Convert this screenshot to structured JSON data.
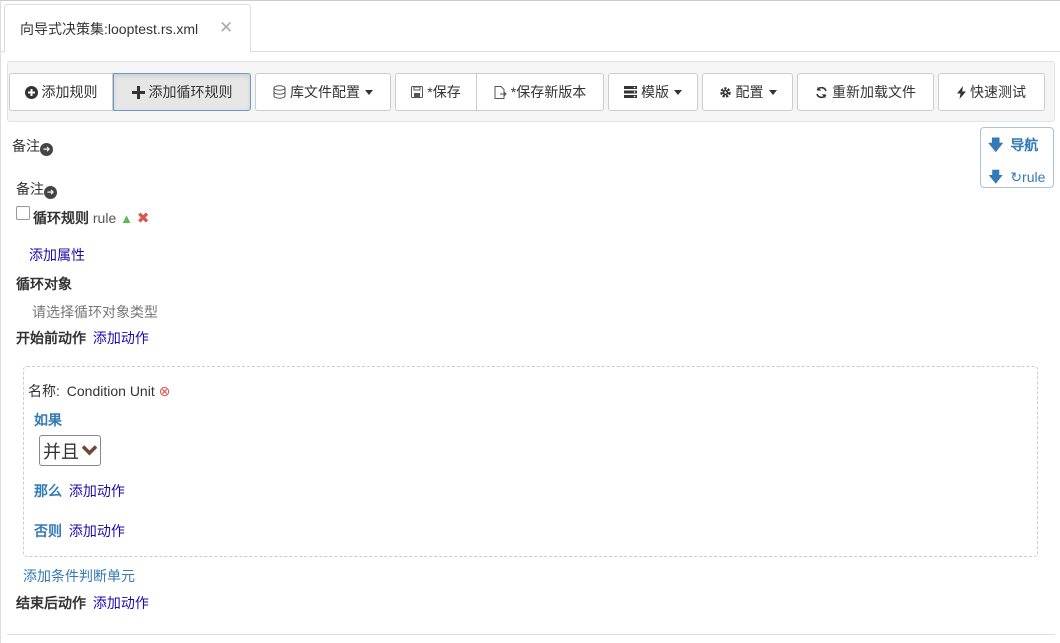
{
  "tab": {
    "title": "向导式决策集:looptest.rs.xml",
    "close": "✕"
  },
  "toolbar": {
    "add_rule": "添加规则",
    "add_loop_rule": "添加循环规则",
    "lib_config": "库文件配置",
    "save": "*保存",
    "save_new_version": "*保存新版本",
    "template": "模版",
    "config": "配置",
    "reload": "重新加载文件",
    "quick_test": "快速测试"
  },
  "nav": {
    "nav_label": "导航",
    "rule_label": "rule"
  },
  "remark_top": "备注",
  "rule": {
    "remark": "备注",
    "type_label": "循环规则",
    "name": "rule",
    "add_attribute": "添加属性",
    "loop_object_label": "循环对象",
    "loop_object_placeholder": "请选择循环对象类型",
    "before_action_label": "开始前动作",
    "before_action_link": "添加动作",
    "condition_unit": {
      "name_label": "名称:",
      "name_value": "Condition Unit",
      "if_label": "如果",
      "operator": "并且",
      "then_label": "那么",
      "then_link": "添加动作",
      "else_label": "否则",
      "else_link": "添加动作"
    },
    "add_condition_unit": "添加条件判断单元",
    "after_action_label": "结束后动作",
    "after_action_link": "添加动作"
  },
  "colors": {
    "link": "#1a0dab",
    "accent": "#337ab7",
    "delete": "#d9534f",
    "tree": "#5cb85c"
  }
}
